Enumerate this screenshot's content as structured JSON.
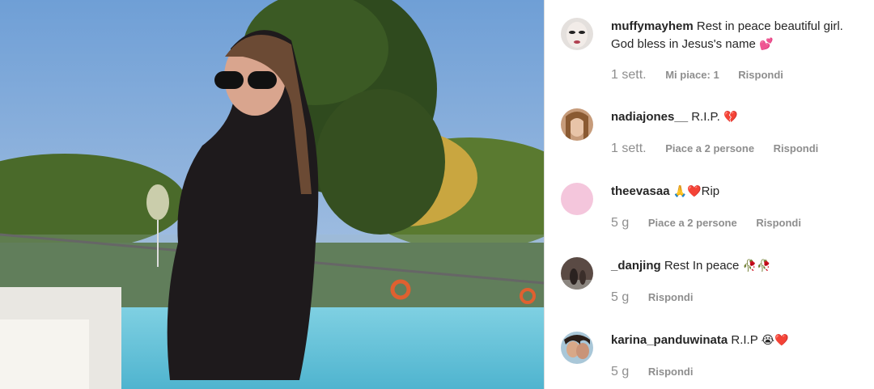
{
  "colors": {
    "text": "#262626",
    "meta": "#8e8e8e",
    "heart": "#d9324a"
  },
  "photo": {
    "description_icon": "post-photo"
  },
  "comments": [
    {
      "username": "muffymayhem",
      "text": "Rest in peace beautiful girl. God bless in Jesus's name",
      "emoji": "💕",
      "time": "1 sett.",
      "likes": "Mi piace: 1",
      "reply": "Rispondi"
    },
    {
      "username": "nadiajones__",
      "text": "R.I.P.",
      "emoji": "💔",
      "time": "1 sett.",
      "likes": "Piace a 2 persone",
      "reply": "Rispondi"
    },
    {
      "username": "theevasaa",
      "text": "Rip",
      "emoji": "🙏❤️",
      "time": "5 g",
      "likes": "Piace a 2 persone",
      "reply": "Rispondi"
    },
    {
      "username": "_danjing",
      "text": "Rest In peace",
      "emoji": "🥀🥀",
      "time": "5 g",
      "likes": "",
      "reply": "Rispondi"
    },
    {
      "username": "karina_panduwinata",
      "text": "R.I.P",
      "emoji": "😭❤️",
      "time": "5 g",
      "likes": "",
      "reply": "Rispondi"
    }
  ]
}
